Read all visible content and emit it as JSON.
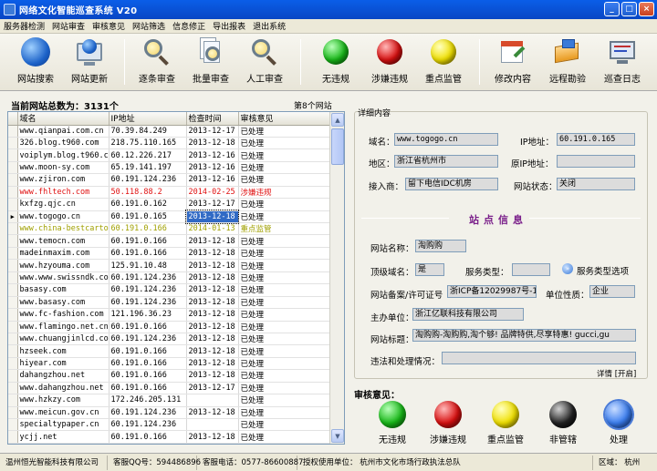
{
  "window": {
    "title": "网络文化智能巡查系统  V20",
    "min": "_",
    "max": "□",
    "close": "×"
  },
  "menu": [
    "服务器检测",
    "网站审查",
    "审核意见",
    "网站筛选",
    "信息修正",
    "导出报表",
    "退出系统"
  ],
  "toolbar": [
    {
      "label": "网站搜索",
      "icon": "globe-icon"
    },
    {
      "label": "网站更新",
      "icon": "monitor-globe-icon"
    },
    {
      "label": "逐条审查",
      "icon": "magnifier-icon"
    },
    {
      "label": "批量审查",
      "icon": "documents-magnifier-icon"
    },
    {
      "label": "人工审查",
      "icon": "magnifier-icon"
    },
    {
      "label": "无违规",
      "icon": "green-light-icon"
    },
    {
      "label": "涉嫌违规",
      "icon": "red-light-icon"
    },
    {
      "label": "重点监管",
      "icon": "yellow-light-icon"
    },
    {
      "label": "修改内容",
      "icon": "calendar-edit-icon"
    },
    {
      "label": "远程勘验",
      "icon": "remote-check-icon"
    },
    {
      "label": "巡查日志",
      "icon": "monitor-log-icon"
    }
  ],
  "list": {
    "total_label": "当前网站总数为：3131个",
    "current_label": "第8个网站",
    "columns": [
      "域名",
      "IP地址",
      "检查时间",
      "审核意见"
    ],
    "rows": [
      [
        "www.qianpai.com.cn",
        "70.39.84.249",
        "2013-12-17",
        "已处理"
      ],
      [
        "326.blog.t960.com",
        "218.75.110.165",
        "2013-12-18",
        "已处理"
      ],
      [
        "voiplym.blog.t960.co",
        "60.12.226.217",
        "2013-12-16",
        "已处理"
      ],
      [
        "www.moon-sy.com",
        "65.19.141.197",
        "2013-12-16",
        "已处理"
      ],
      [
        "www.zjiron.com",
        "60.191.124.236",
        "2013-12-16",
        "已处理"
      ],
      [
        "www.fhltech.com",
        "50.118.88.2",
        "2014-02-25",
        "涉嫌违规"
      ],
      [
        "kxfzg.qjc.cn",
        "60.191.0.162",
        "2013-12-17",
        "已处理"
      ],
      [
        "www.togogo.cn",
        "60.191.0.165",
        "2013-12-18",
        "已处理"
      ],
      [
        "www.china-bestcartoo",
        "60.191.0.166",
        "2014-01-13",
        "重点监管"
      ],
      [
        "www.temocn.com",
        "60.191.0.166",
        "2013-12-18",
        "已处理"
      ],
      [
        "madeinmaxim.com",
        "60.191.0.166",
        "2013-12-18",
        "已处理"
      ],
      [
        "www.hzyouma.com",
        "125.91.10.48",
        "2013-12-18",
        "已处理"
      ],
      [
        "www.www.swissndk.com",
        "60.191.124.236",
        "2013-12-18",
        "已处理"
      ],
      [
        "basasy.com",
        "60.191.124.236",
        "2013-12-18",
        "已处理"
      ],
      [
        "www.basasy.com",
        "60.191.124.236",
        "2013-12-18",
        "已处理"
      ],
      [
        "www.fc-fashion.com",
        "121.196.36.23",
        "2013-12-18",
        "已处理"
      ],
      [
        "www.flamingo.net.cn",
        "60.191.0.166",
        "2013-12-18",
        "已处理"
      ],
      [
        "www.chuangjinlcd.com",
        "60.191.124.236",
        "2013-12-18",
        "已处理"
      ],
      [
        "hzseek.com",
        "60.191.0.166",
        "2013-12-18",
        "已处理"
      ],
      [
        "hiyear.com",
        "60.191.0.166",
        "2013-12-18",
        "已处理"
      ],
      [
        "dahangzhou.net",
        "60.191.0.166",
        "2013-12-18",
        "已处理"
      ],
      [
        "www.dahangzhou.net",
        "60.191.0.166",
        "2013-12-17",
        "已处理"
      ],
      [
        "www.hzkzy.com",
        "172.246.205.131",
        "",
        "已处理"
      ],
      [
        "www.meicun.gov.cn",
        "60.191.124.236",
        "2013-12-18",
        "已处理"
      ],
      [
        "specialtypaper.cn",
        "60.191.124.236",
        "",
        "已处理"
      ],
      [
        "ycjj.net",
        "60.191.0.166",
        "2013-12-18",
        "已处理"
      ]
    ]
  },
  "detail": {
    "legend": "详细内容",
    "domain_label": "域名：",
    "domain": "www.togogo.cn",
    "ip_label": "IP地址：",
    "ip": "60.191.0.165",
    "region_label": "地区：",
    "region": "浙江省杭州市",
    "orig_ip_label": "原IP地址：",
    "orig_ip": "",
    "isp_label": "接入商：",
    "isp": "留下电信IDC机房",
    "state_label": "网站状态：",
    "state": "关闭",
    "section": "站点信息",
    "site_name_label": "网站名称：",
    "site_name": "淘购购",
    "top_domain_label": "顶级域名：",
    "top_domain": "是",
    "service_type_label": "服务类型：",
    "service_type": "",
    "service_option": "服务类型选项",
    "icp_label": "网站备案/许可证号",
    "icp": "浙ICP备12029987号-1",
    "unit_nature_label": "单位性质：",
    "unit_nature": "企业",
    "host_label": "主办单位：",
    "host": "浙江亿联科技有限公司",
    "site_title_label": "网站标题：",
    "site_title": "淘购购-淘购购,淘个够! 品牌特供,尽享特惠! gucci,gu",
    "violation_label": "违法和处理情况：",
    "violation": "",
    "detail_link": "详情 [开启]"
  },
  "review": {
    "title": "审核意见：",
    "buttons": [
      {
        "label": "无违规",
        "color": "#18b818"
      },
      {
        "label": "涉嫌违规",
        "color": "#d81010"
      },
      {
        "label": "重点监管",
        "color": "#f0e000"
      },
      {
        "label": "非管辖",
        "color": "#222222"
      },
      {
        "label": "处理",
        "color": "#3b7ef0"
      }
    ]
  },
  "status": {
    "company": "温州恒光智能科技有限公司",
    "qq": "客服QQ号：594486896",
    "phone": "客服电话：0577-86600887",
    "licensee": "授权使用单位：  杭州市文化市场行政执法总队",
    "region": "区域：  杭州"
  }
}
